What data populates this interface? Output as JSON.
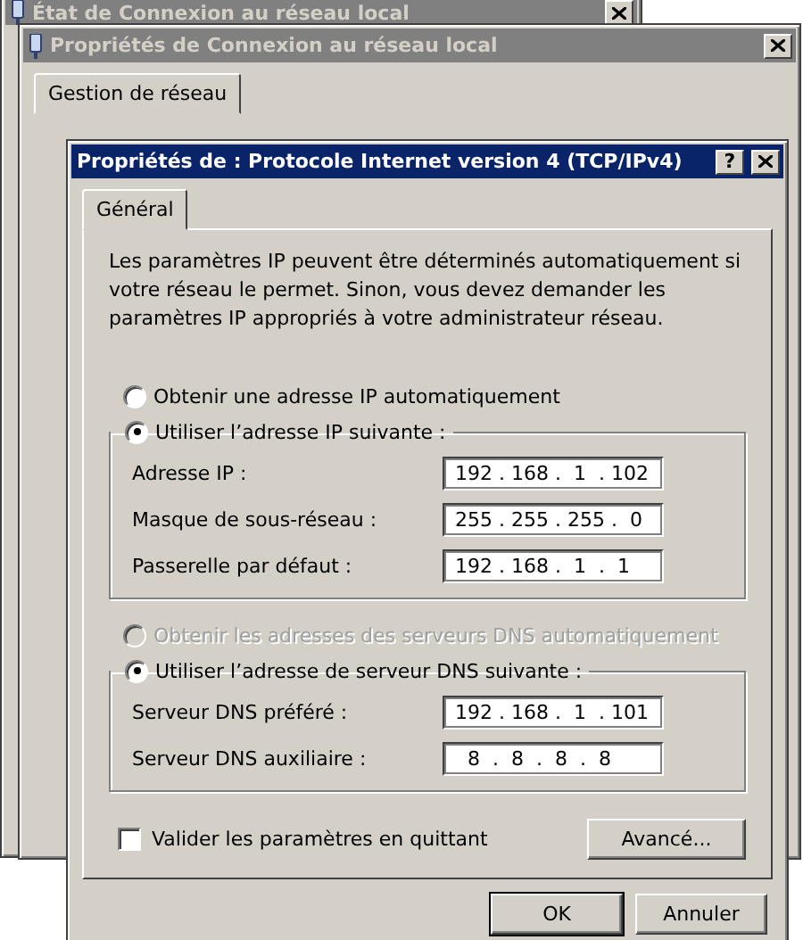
{
  "back_window": {
    "title": "État de Connexion au réseau local"
  },
  "middle_window": {
    "title": "Propriétés de Connexion au réseau local",
    "tabs": [
      {
        "label": "Gestion de réseau",
        "selected": true
      }
    ]
  },
  "dialog": {
    "title": "Propriétés de : Protocole Internet version 4 (TCP/IPv4)",
    "help_button": "?",
    "tabs": [
      {
        "label": "Général",
        "selected": true
      }
    ],
    "description": "Les paramètres IP peuvent être déterminés automatiquement si votre réseau le permet. Sinon, vous devez demander les paramètres IP appropriés à votre administrateur réseau.",
    "ip_auto": {
      "label": "Obtenir une adresse IP automatiquement",
      "selected": false,
      "disabled": false
    },
    "ip_manual": {
      "label": "Utiliser l’adresse IP suivante :",
      "selected": true,
      "disabled": false
    },
    "ip_fields": [
      {
        "label": "Adresse IP :",
        "value": "192 . 168 .  1  . 102"
      },
      {
        "label": "Masque de sous-réseau :",
        "value": "255 . 255 . 255 .  0"
      },
      {
        "label": "Passerelle par défaut :",
        "value": "192 . 168 .  1  .  1"
      }
    ],
    "dns_auto": {
      "label": "Obtenir les adresses des serveurs DNS automatiquement",
      "selected": false,
      "disabled": true
    },
    "dns_manual": {
      "label": "Utiliser l’adresse de serveur DNS suivante :",
      "selected": true,
      "disabled": false
    },
    "dns_fields": [
      {
        "label": "Serveur DNS préféré :",
        "value": "192 . 168 .  1  . 101"
      },
      {
        "label": "Serveur DNS auxiliaire :",
        "value": "  8  .  8  .  8  .  8"
      }
    ],
    "validate": {
      "label": "Valider les paramètres en quittant",
      "checked": false
    },
    "advanced_button": "Avancé...",
    "buttons": [
      {
        "label": "OK",
        "default": true
      },
      {
        "label": "Annuler",
        "default": false
      }
    ]
  }
}
